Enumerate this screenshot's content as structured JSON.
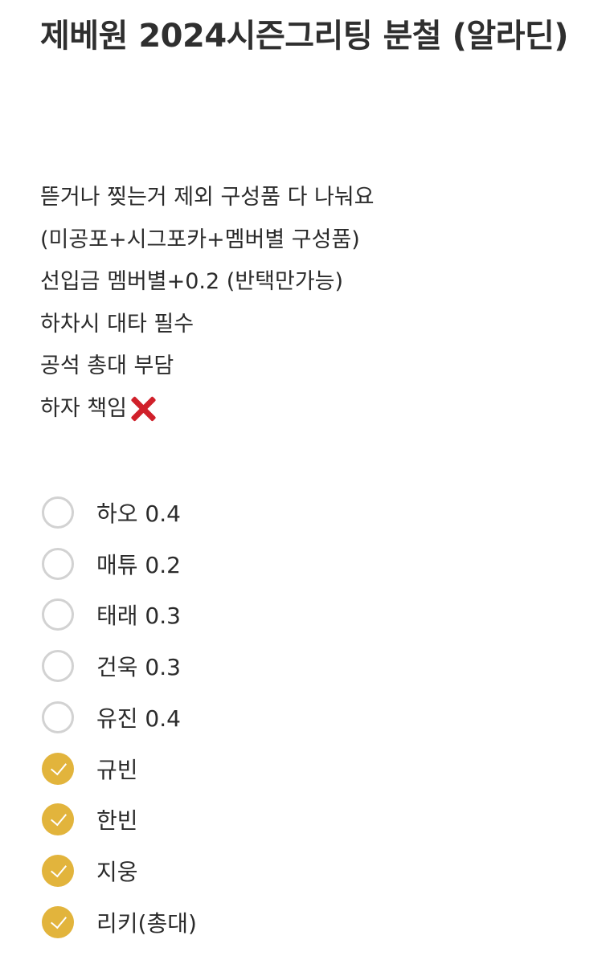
{
  "title": "제베원 2024시즌그리팅 분철 (알라딘)",
  "description": [
    "뜯거나 찢는거 제외 구성품 다 나눠요",
    "(미공포+시그포카+멤버별 구성품)",
    "선입금 멤버별+0.2 (반택만가능)",
    "하차시 대타 필수",
    "공석 총대 부담",
    "하자 책임"
  ],
  "description_last_icon": "red-x-icon",
  "checklist": [
    {
      "label": "하오 0.4",
      "checked": false
    },
    {
      "label": "매튜 0.2",
      "checked": false
    },
    {
      "label": "태래 0.3",
      "checked": false
    },
    {
      "label": "건욱 0.3",
      "checked": false
    },
    {
      "label": "유진 0.4",
      "checked": false
    },
    {
      "label": "규빈",
      "checked": true
    },
    {
      "label": "한빈",
      "checked": true
    },
    {
      "label": "지웅",
      "checked": true
    },
    {
      "label": "리키(총대)",
      "checked": true
    }
  ],
  "colors": {
    "checked": "#e2b43c",
    "unchecked_border": "#d2d2d2",
    "x_icon": "#d0202a"
  }
}
